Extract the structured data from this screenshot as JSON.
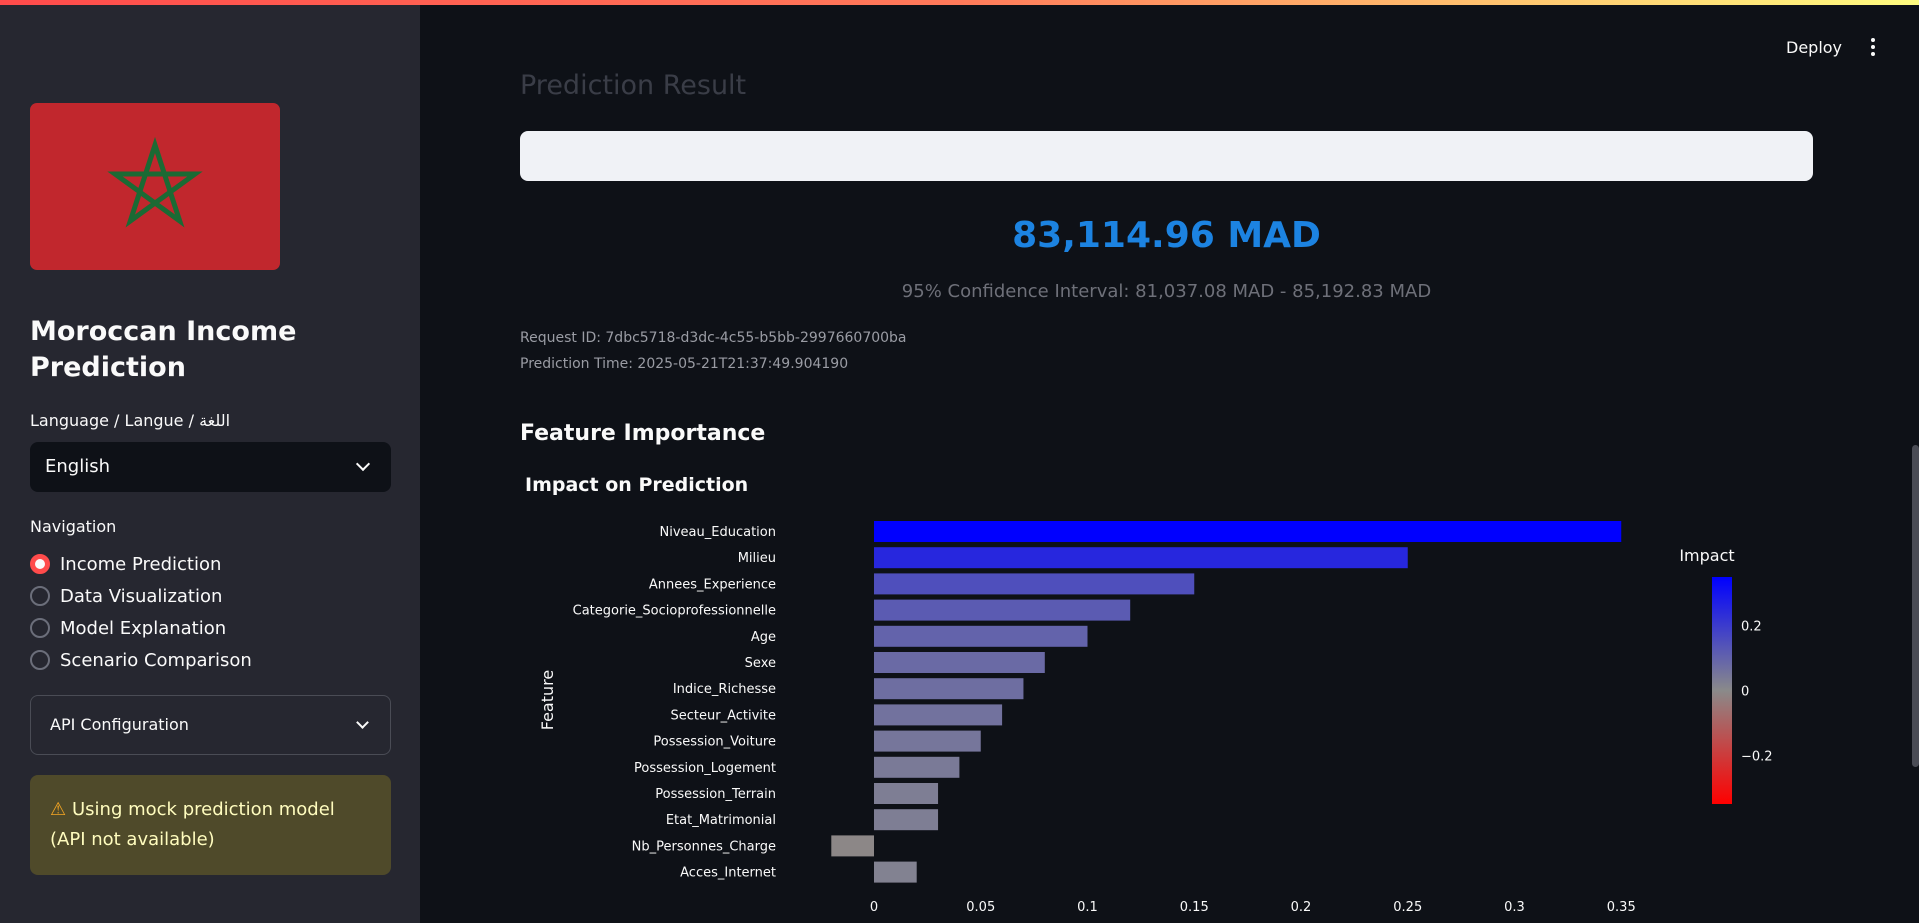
{
  "header": {
    "deploy_label": "Deploy"
  },
  "sidebar": {
    "app_title": "Moroccan Income Prediction",
    "language_label": "Language / Langue / اللغة",
    "language_value": "English",
    "navigation_label": "Navigation",
    "nav_items": [
      {
        "label": "Income Prediction",
        "selected": true
      },
      {
        "label": "Data Visualization",
        "selected": false
      },
      {
        "label": "Model Explanation",
        "selected": false
      },
      {
        "label": "Scenario Comparison",
        "selected": false
      }
    ],
    "api_config_label": "API Configuration",
    "warning_text": "Using mock prediction model (API not available)"
  },
  "main": {
    "section_title": "Prediction Result",
    "predicted_value": "83,114.96 MAD",
    "confidence_interval": "95% Confidence Interval: 81,037.08 MAD - 85,192.83 MAD",
    "request_id": "Request ID: 7dbc5718-d3dc-4c55-b5bb-2997660700ba",
    "prediction_time": "Prediction Time: 2025-05-21T21:37:49.904190",
    "feature_importance_title": "Feature Importance"
  },
  "colors": {
    "accent": "#ff4b4b",
    "value_blue": "#1c83e1",
    "impact_high": "#0000ff",
    "impact_low": "#ff0000",
    "sidebar_bg": "#262730",
    "main_bg": "#0e1117"
  },
  "chart_data": {
    "type": "bar",
    "orientation": "horizontal",
    "title": "Impact on Prediction",
    "ylabel": "Feature",
    "xlabel": "",
    "categories": [
      "Niveau_Education",
      "Milieu",
      "Annees_Experience",
      "Categorie_Socioprofessionnelle",
      "Age",
      "Sexe",
      "Indice_Richesse",
      "Secteur_Activite",
      "Possession_Voiture",
      "Possession_Logement",
      "Possession_Terrain",
      "Etat_Matrimonial",
      "Nb_Personnes_Charge",
      "Acces_Internet"
    ],
    "values": [
      0.35,
      0.25,
      0.15,
      0.12,
      0.1,
      0.08,
      0.07,
      0.06,
      0.05,
      0.04,
      0.03,
      0.03,
      -0.02,
      0.02
    ],
    "x_ticks": [
      "0",
      "0.05",
      "0.1",
      "0.15",
      "0.2",
      "0.25",
      "0.3",
      "0.35"
    ],
    "xlim": [
      -0.02,
      0.35
    ],
    "colorbar": {
      "title": "Impact",
      "ticks": [
        "0.2",
        "0",
        "−0.2"
      ],
      "range": [
        -0.35,
        0.35
      ]
    }
  }
}
